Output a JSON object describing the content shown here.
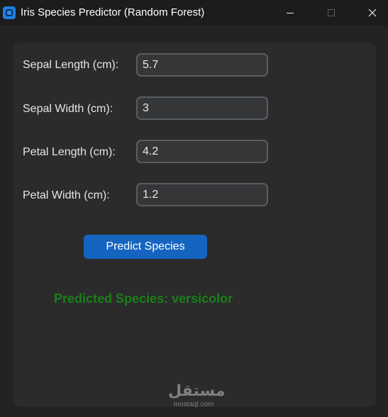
{
  "window": {
    "title": "Iris Species Predictor (Random Forest)",
    "controls": [
      "minimize",
      "maximize",
      "close"
    ]
  },
  "form": {
    "fields": [
      {
        "label": "Sepal Length (cm):",
        "value": "5.7"
      },
      {
        "label": "Sepal Width (cm):",
        "value": "3"
      },
      {
        "label": "Petal Length (cm):",
        "value": "4.2"
      },
      {
        "label": "Petal Width (cm):",
        "value": "1.2"
      }
    ],
    "predict_button": "Predict Species",
    "result": "Predicted Species: versicolor"
  },
  "watermark": {
    "logo": "مستقل",
    "url": "mostaql.com"
  },
  "colors": {
    "accent": "#1565c0",
    "result_text": "#1a7f1a",
    "panel": "#2b2b2b",
    "background": "#232323"
  }
}
